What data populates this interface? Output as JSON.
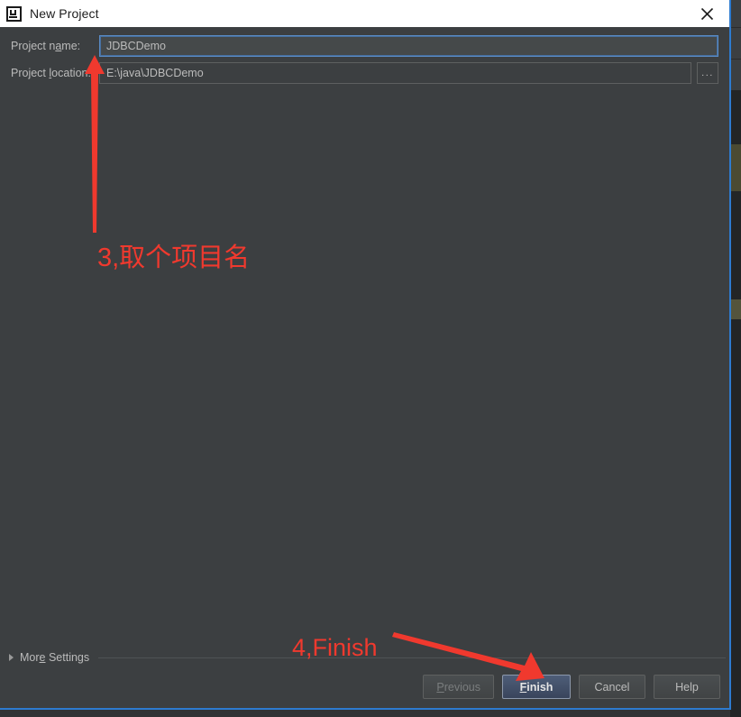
{
  "window": {
    "title": "New Project",
    "app_icon": "intellij-idea-icon",
    "close_icon": "close-icon",
    "border_color": "#2d7bd0",
    "background_color": "#3c3f41",
    "titlebar_background": "#ffffff"
  },
  "form": {
    "fields": [
      {
        "label_before": "Project n",
        "label_mnemonic": "a",
        "label_after": "me:",
        "value": "JDBCDemo",
        "placeholder": "",
        "focused": true
      },
      {
        "label_before": "Project ",
        "label_mnemonic": "l",
        "label_after": "ocation:",
        "value": "E:\\java\\JDBCDemo",
        "placeholder": "",
        "focused": false
      }
    ],
    "browse_button_label": "...",
    "focus_border_color": "#5a8bc4"
  },
  "more_settings": {
    "label_before": "Mor",
    "label_mnemonic": "e",
    "label_after": " Settings",
    "expanded": false,
    "disclosure_icon": "chevron-right-icon"
  },
  "buttons": [
    {
      "name": "previous",
      "label_before": "",
      "label_mnemonic": "P",
      "label_after": "revious",
      "state": "disabled",
      "default": false
    },
    {
      "name": "finish",
      "label_before": "",
      "label_mnemonic": "F",
      "label_after": "inish",
      "state": "enabled",
      "default": true
    },
    {
      "name": "cancel",
      "label_before": "Cancel",
      "label_mnemonic": "",
      "label_after": "",
      "state": "enabled",
      "default": false
    },
    {
      "name": "help",
      "label_before": "Help",
      "label_mnemonic": "",
      "label_after": "",
      "state": "enabled",
      "default": false
    }
  ],
  "annotations": {
    "color": "#f0392e",
    "step3_text": "3,取个项目名",
    "step4_text": "4,Finish",
    "arrow_up_target": "project-name-input",
    "arrow_diagonal_target": "finish-button"
  }
}
